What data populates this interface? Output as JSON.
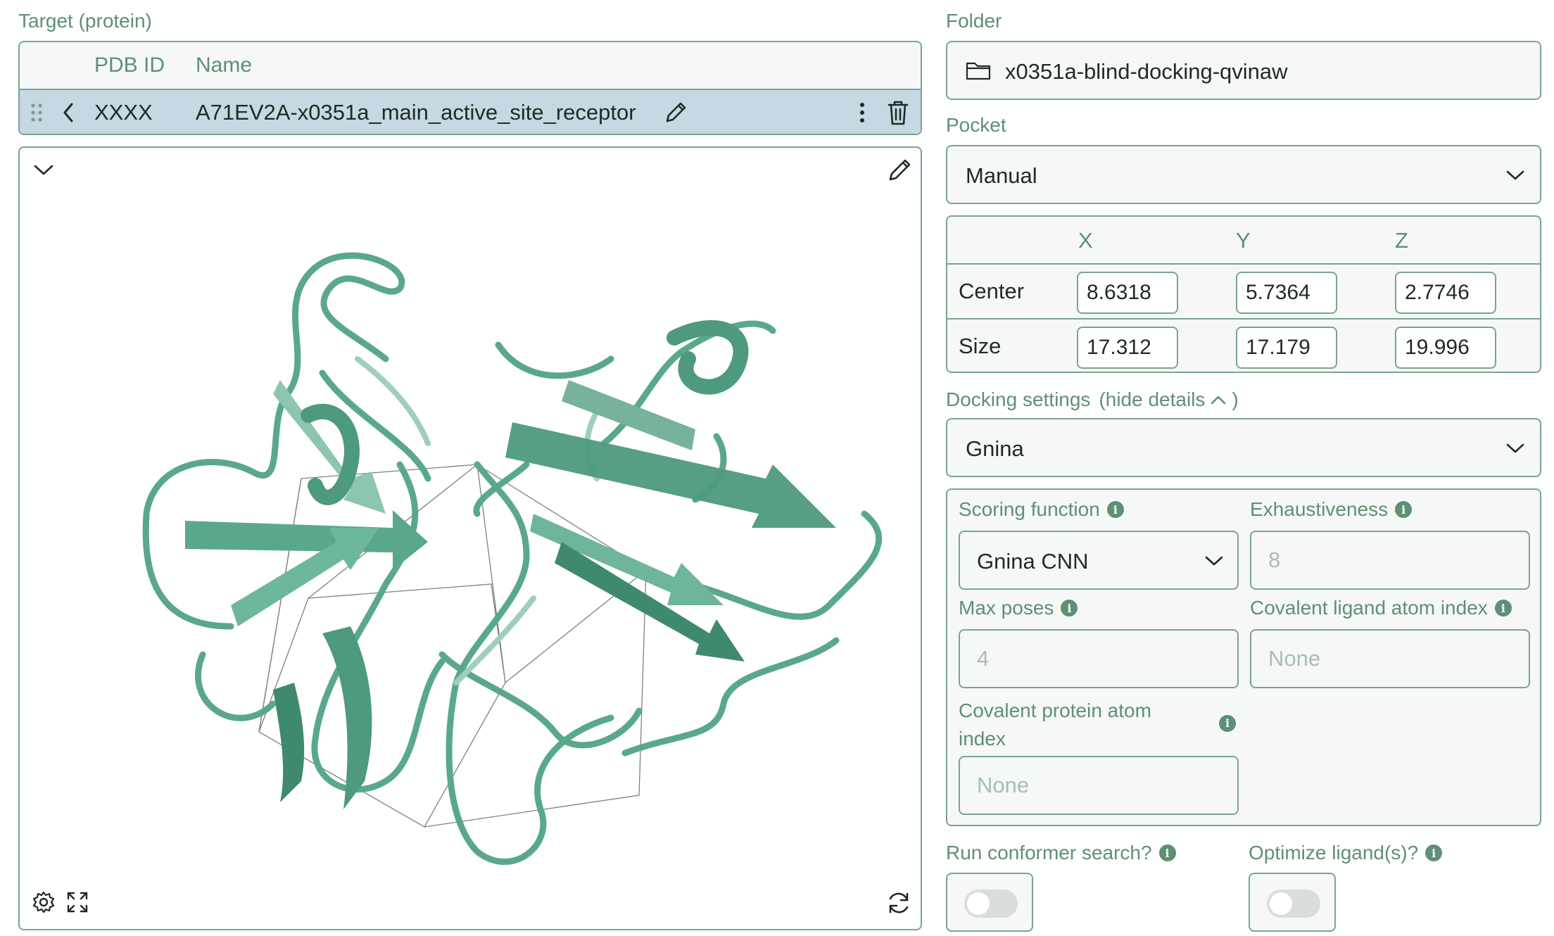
{
  "target": {
    "section_label": "Target (protein)",
    "columns": {
      "pdb_id": "PDB ID",
      "name": "Name"
    },
    "row": {
      "pdb_id": "XXXX",
      "name": "A71EV2A-x0351a_main_active_site_receptor"
    }
  },
  "folder": {
    "label": "Folder",
    "value": "x0351a-blind-docking-qvinaw"
  },
  "pocket": {
    "label": "Pocket",
    "selected": "Manual",
    "headers": {
      "x": "X",
      "y": "Y",
      "z": "Z"
    },
    "center": {
      "label": "Center",
      "x": "8.6318",
      "y": "5.7364",
      "z": "2.7746"
    },
    "size": {
      "label": "Size",
      "x": "17.312",
      "y": "17.179",
      "z": "19.996"
    }
  },
  "docking": {
    "label": "Docking settings",
    "details_link": "(hide details",
    "details_close": ")",
    "engine": "Gnina",
    "scoring_function": {
      "label": "Scoring function",
      "selected": "Gnina CNN"
    },
    "exhaustiveness": {
      "label": "Exhaustiveness",
      "placeholder": "8"
    },
    "max_poses": {
      "label": "Max poses",
      "placeholder": "4"
    },
    "covalent_ligand": {
      "label": "Covalent ligand atom index",
      "placeholder": "None"
    },
    "covalent_protein": {
      "label_line1": "Covalent protein atom",
      "label_line2": "index",
      "placeholder": "None"
    }
  },
  "options": {
    "conformer_search": {
      "label": "Run conformer search?",
      "enabled": false
    },
    "optimize_ligands": {
      "label": "Optimize ligand(s)?",
      "enabled": false
    }
  },
  "colors": {
    "accent": "#5f8f74",
    "border": "#79a58b",
    "protein": "#5aa88a",
    "selected_row": "#c6d8e2"
  }
}
